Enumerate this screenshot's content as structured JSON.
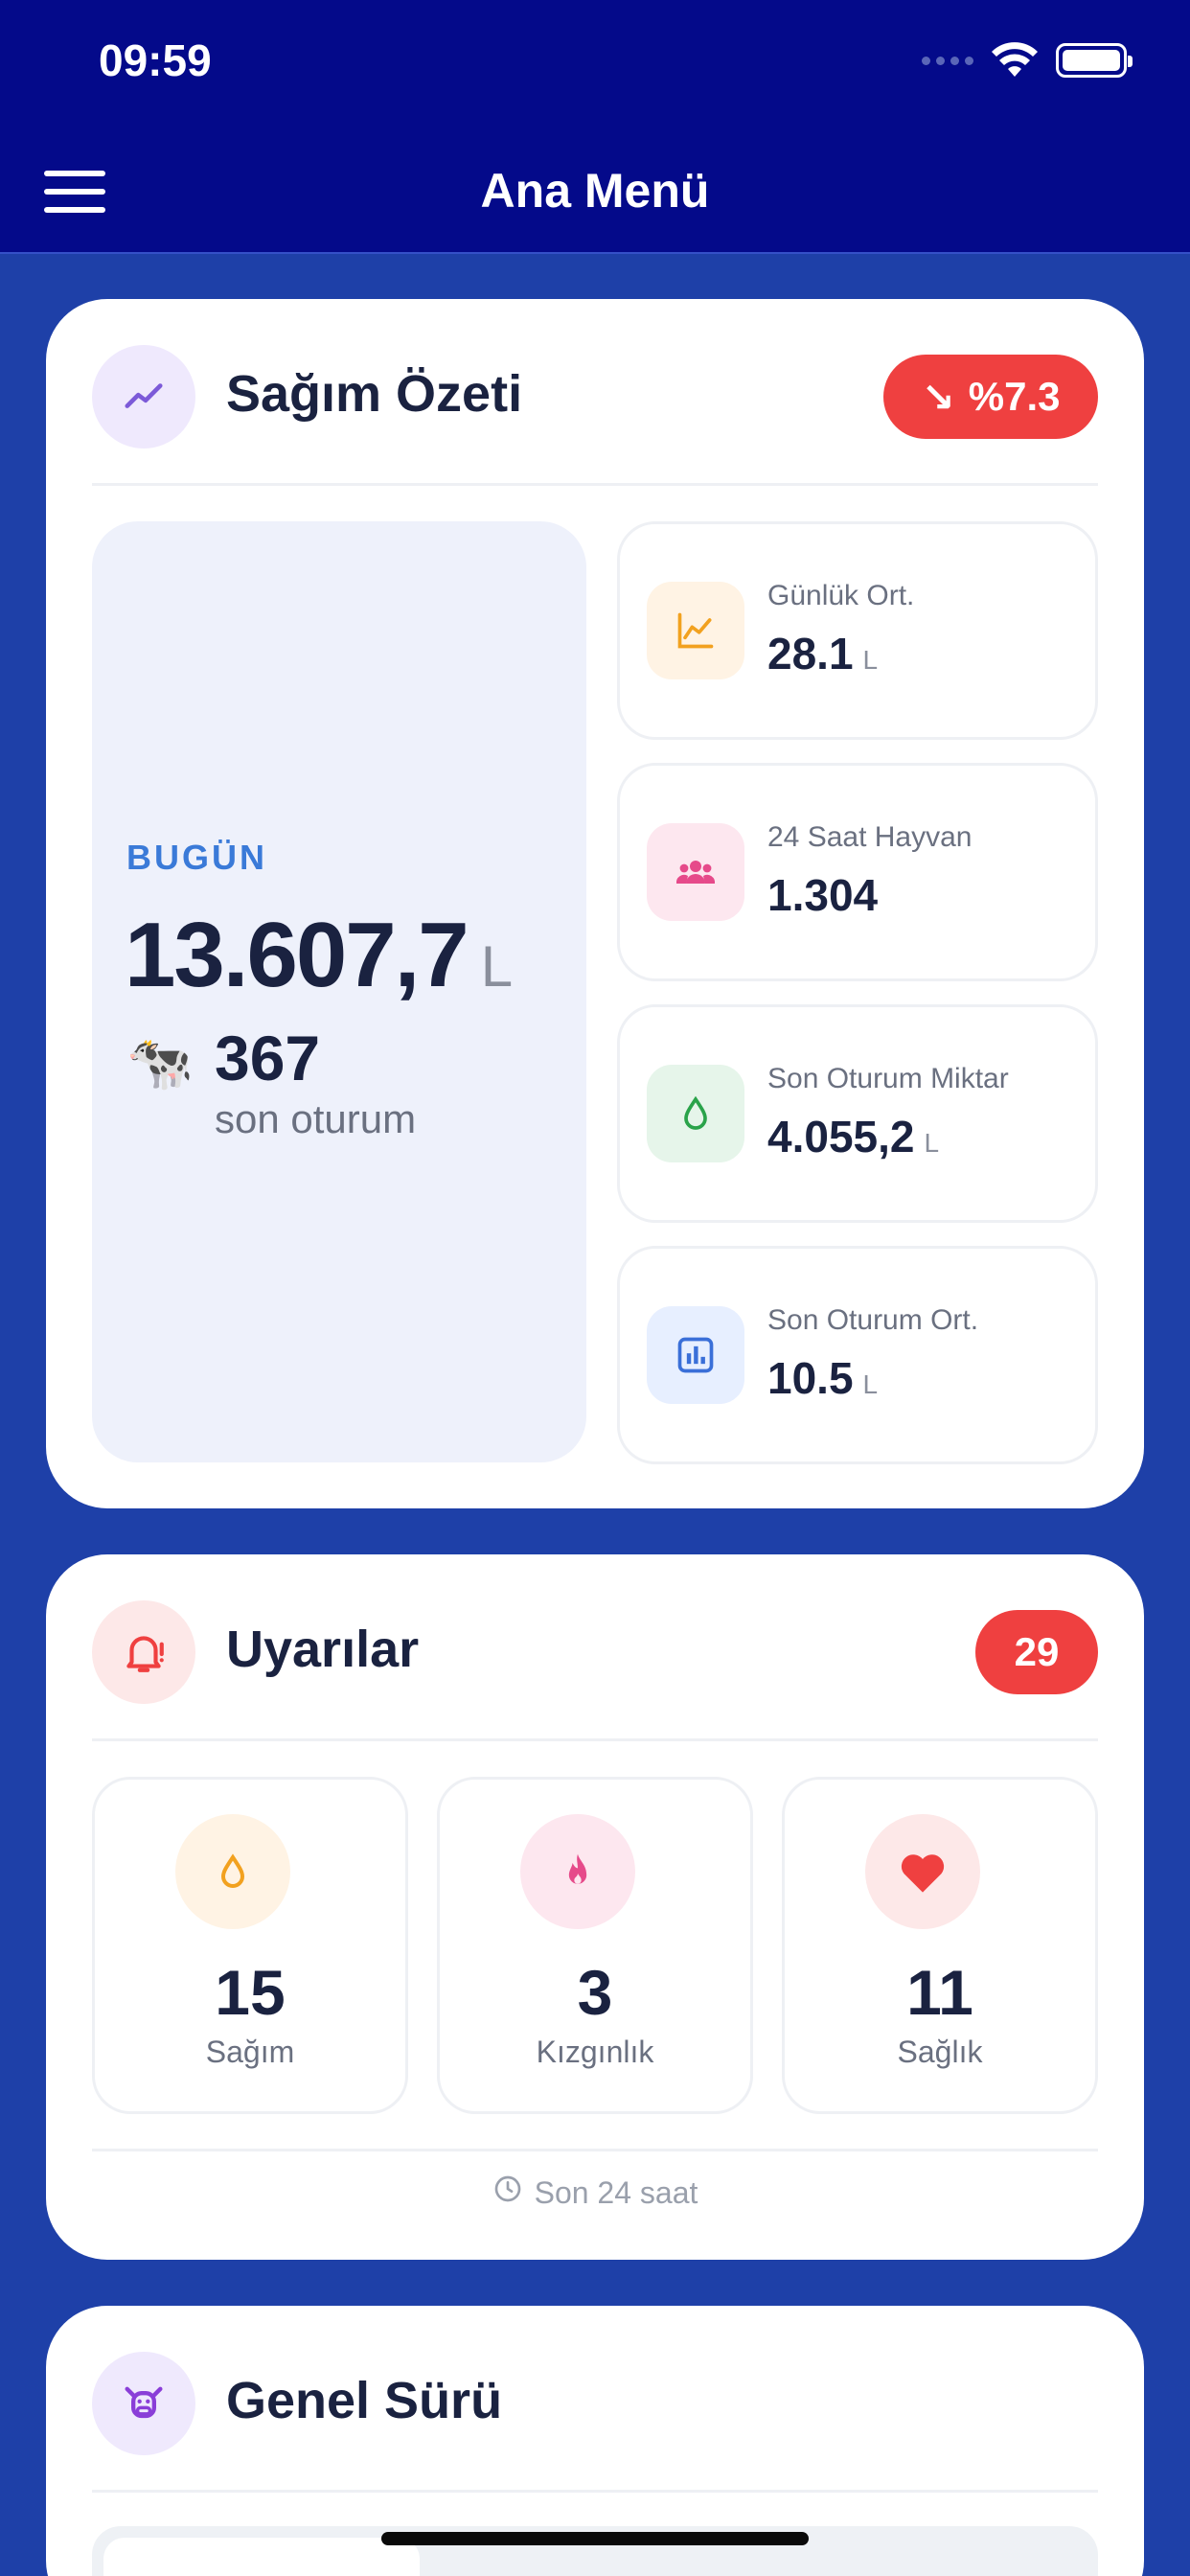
{
  "status_bar": {
    "time": "09:59"
  },
  "header": {
    "title": "Ana Menü",
    "menu_icon": "hamburger-menu-icon"
  },
  "milking_summary": {
    "title": "Sağım Özeti",
    "icon": "trend-line-icon",
    "change_badge": {
      "text": "%7.3",
      "arrow": "↘",
      "color": "#ef4040"
    },
    "today": {
      "label": "BUGÜN",
      "value": "13.607,7",
      "unit": "L",
      "session_count": "367",
      "session_label": "son oturum",
      "emoji": "🐄"
    },
    "stats": [
      {
        "label": "Günlük Ort.",
        "value": "28.1",
        "unit": "L",
        "icon": "line-chart-icon",
        "color": "#f2a11f"
      },
      {
        "label": "24 Saat Hayvan",
        "value": "1.304",
        "unit": "",
        "icon": "group-icon",
        "color": "#e64a8a"
      },
      {
        "label": "Son Oturum Miktar",
        "value": "4.055,2",
        "unit": "L",
        "icon": "drop-icon",
        "color": "#2aa34a"
      },
      {
        "label": "Son Oturum Ort.",
        "value": "10.5",
        "unit": "L",
        "icon": "bar-chart-icon",
        "color": "#3a6fd8"
      }
    ]
  },
  "alerts": {
    "title": "Uyarılar",
    "icon": "bell-alert-icon",
    "count": "29",
    "items": [
      {
        "value": "15",
        "label": "Sağım",
        "icon": "drop-icon",
        "color": "#f2a11f"
      },
      {
        "value": "3",
        "label": "Kızgınlık",
        "icon": "flame-icon",
        "color": "#e64a8a"
      },
      {
        "value": "11",
        "label": "Sağlık",
        "icon": "heart-icon",
        "color": "#ef4040"
      }
    ],
    "footer": "Son 24 saat"
  },
  "herd": {
    "title": "Genel Sürü",
    "icon": "cow-face-icon"
  }
}
